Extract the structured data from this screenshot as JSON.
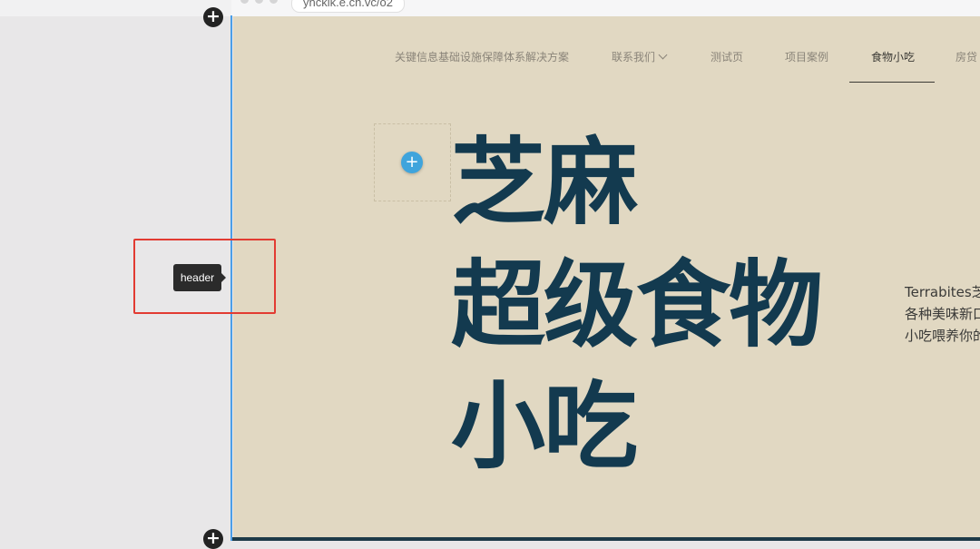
{
  "browser": {
    "url": "yncklk.e.cn.vc/o2"
  },
  "nav": {
    "items": [
      {
        "label": "关键信息基础设施保障体系解决方案",
        "active": false
      },
      {
        "label": "联系我们",
        "active": false,
        "has_dropdown": true
      },
      {
        "label": "测试页",
        "active": false
      },
      {
        "label": "项目案例",
        "active": false
      },
      {
        "label": "食物小吃",
        "active": true
      },
      {
        "label": "房贷",
        "active": false
      }
    ]
  },
  "hero": {
    "line1": "芝麻",
    "line2": "超级食物",
    "line3": "小吃"
  },
  "description": {
    "line1": "Terrabites芝",
    "line2": "各种美味新口",
    "line3": "小吃喂养你的"
  },
  "editor": {
    "tooltip_label": "header",
    "add_section_symbol": "+",
    "add_block_symbol": "+"
  },
  "colors": {
    "page_bg": "#e1d8c2",
    "hero_text": "#133a4f",
    "accent_blue": "#3fa4dc",
    "highlight_red": "#e23b32",
    "guide_line": "#4a9ee8"
  }
}
